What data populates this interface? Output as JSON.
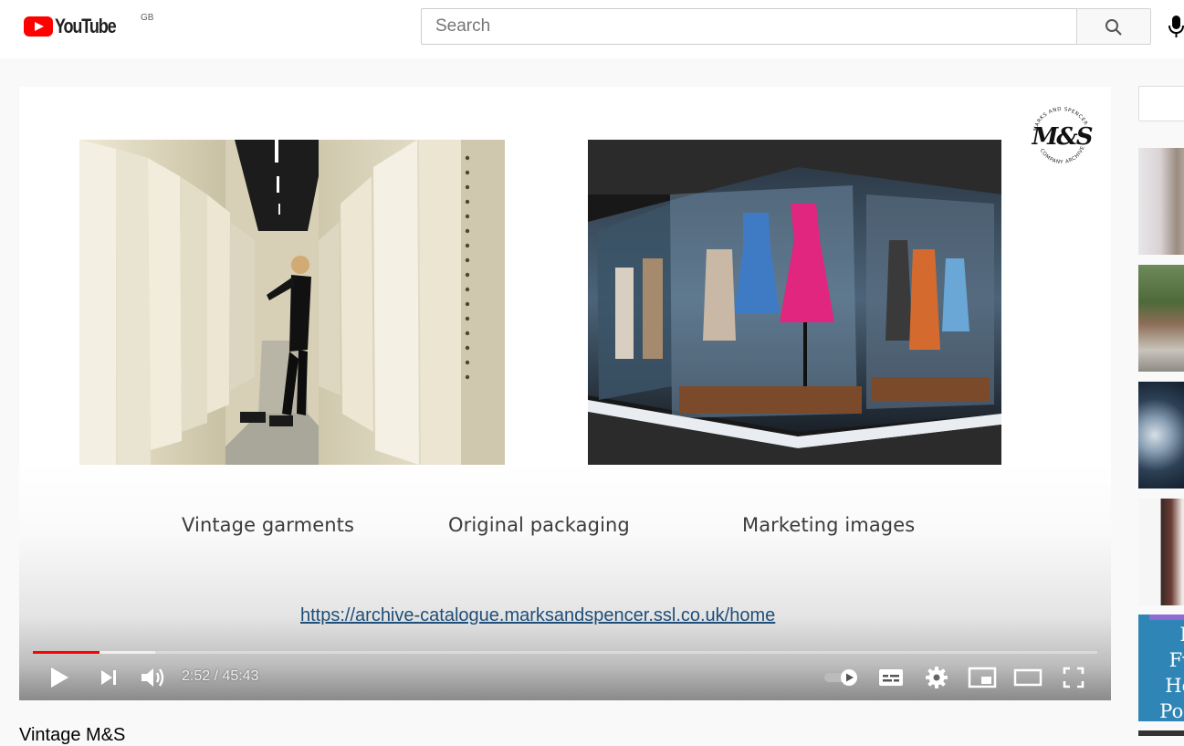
{
  "header": {
    "logo_text": "YouTube",
    "country_code": "GB",
    "search_placeholder": "Search"
  },
  "player": {
    "slide": {
      "logo_letters": "M&S",
      "logo_ring_top": "MARKS AND SPENCER",
      "logo_ring_bottom": "COMPANY ARCHIVE",
      "captions": [
        "Vintage garments",
        "Original packaging",
        "Marketing images"
      ],
      "link": "https://archive-catalogue.marksandspencer.ssl.co.uk/home"
    },
    "progress": {
      "played_fraction": 0.063,
      "buffered_fraction": 0.115
    },
    "time": "2:52 / 45:43"
  },
  "video": {
    "title": "Vintage M&S"
  },
  "sidebar": {
    "partial_thumbnail_text": "F\nFv\nHe\nPos"
  },
  "colors": {
    "brand_red": "#ff0000",
    "link_blue": "#1f4e79"
  }
}
